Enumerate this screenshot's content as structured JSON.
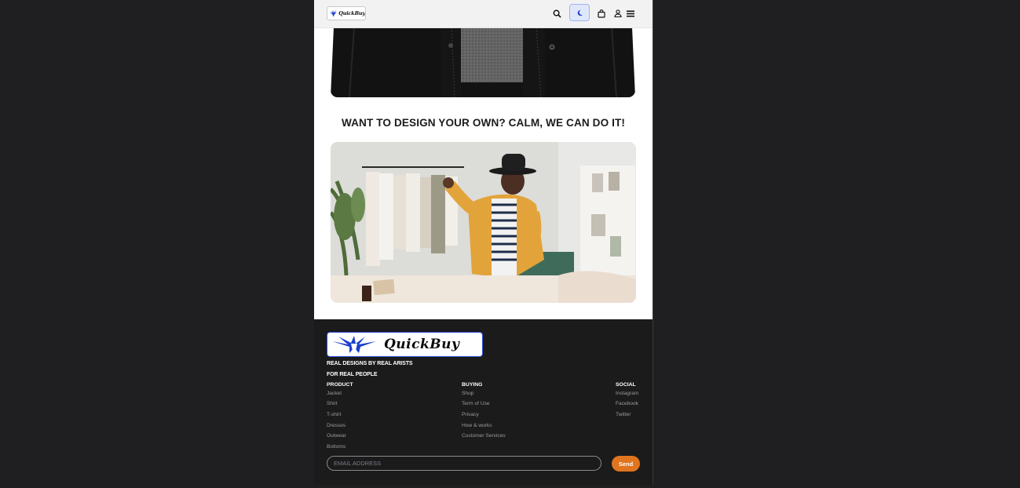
{
  "header": {
    "logo_text": "QuickBuy",
    "icons": [
      "search-icon",
      "moon-icon",
      "bag-icon",
      "user-icon",
      "menu-icon"
    ]
  },
  "main": {
    "headline": "WANT TO DESIGN YOUR OWN? CALM, WE CAN DO IT!"
  },
  "footer": {
    "logo_text": "QuickBuy",
    "tagline_line1": "REAL DESIGNS BY REAL ARISTS",
    "tagline_line2": "FOR REAL PEOPLE",
    "columns": [
      {
        "heading": "PRODUCT",
        "items": [
          "Jacket",
          "Shirt",
          "T-shirt",
          "Dresses",
          "Outwear",
          "Bottoms"
        ]
      },
      {
        "heading": "BUYING",
        "items": [
          "Shop",
          "Term of Use",
          "Privacy",
          "How & works",
          "Customer Services"
        ]
      },
      {
        "heading": "SOCIAL",
        "items": [
          "Instagram",
          "Facebook",
          "Twitter"
        ]
      }
    ],
    "email_placeholder": "EMAIL ADDRESS",
    "send_label": "Send"
  },
  "colors": {
    "page_bg": "#1f1f21",
    "footer_bg": "#1b1b1b",
    "accent": "#e0751f",
    "theme_toggle": "#dfe8fb"
  }
}
